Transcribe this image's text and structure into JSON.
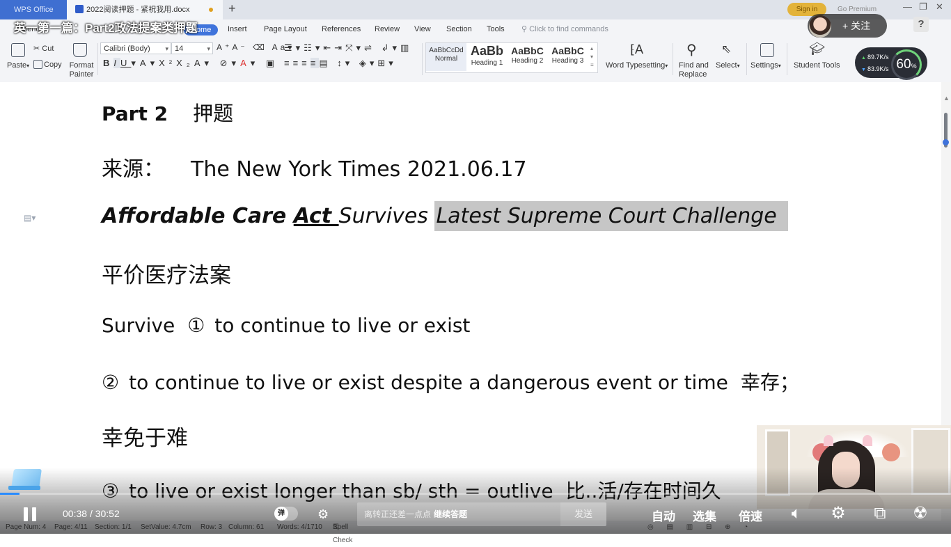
{
  "titlebar": {
    "wps_tab": "WPS Office",
    "doc_tab": "2022阅读押题 - 紧祝我用.docx",
    "new_tab": "+",
    "sign_in": "Sign in",
    "go_premium": "Go Premium"
  },
  "overlay": {
    "video_title": "英一第一篇：Part2政法提案类押题",
    "follow_label": "关注",
    "help": "?"
  },
  "menu": {
    "tabs": [
      "Menu",
      "Home",
      "Insert",
      "Page Layout",
      "References",
      "Review",
      "View",
      "Section",
      "Tools"
    ],
    "active_tab": "Home",
    "search_placeholder": "Click to find commands"
  },
  "ribbon": {
    "paste": "Paste",
    "cut": "Cut",
    "copy": "Copy",
    "format_painter": "Format Painter",
    "font_name": "Calibri (Body)",
    "font_size": "14",
    "styles": [
      {
        "preview": "AaBbCcDd",
        "label": "Normal"
      },
      {
        "preview": "AaBb",
        "label": "Heading 1"
      },
      {
        "preview": "AaBbC",
        "label": "Heading 2"
      },
      {
        "preview": "AaBbC",
        "label": "Heading 3"
      }
    ],
    "word_typesetting": "Word Typesetting",
    "find_replace": "Find and Replace",
    "select": "Select",
    "settings": "Settings",
    "student_tools": "Student Tools"
  },
  "speed_widget": {
    "upload": "89.7",
    "download": "83.9",
    "unit": "K/s",
    "percent": "60",
    "percent_sign": "%"
  },
  "document": {
    "part": "Part 2",
    "part_title": "押题",
    "source_label": "来源：",
    "source_value": "The New York Times 2021.06.17",
    "headline_bold1": "Affordable Care ",
    "headline_underlined": "Act ",
    "headline_normal": "Survives ",
    "headline_highlighted": "Latest Supreme Court Challenge",
    "translation": "平价医疗法案",
    "survive_word": "Survive",
    "def1_num": "①",
    "def1": "to continue to live or exist",
    "def2_num": "②",
    "def2": "to continue to live or exist despite a dangerous event or time",
    "def2_cn": "幸存；",
    "def2_cn2": "幸免于难",
    "def3_num": "③",
    "def3": "to live or exist longer than sb/ sth = outlive",
    "def3_cn": "比..活/存在时间久"
  },
  "statusbar": {
    "page_num": "Page Num: 4",
    "page": "Page: 4/11",
    "section": "Section: 1/1",
    "set_value": "SetValue: 4.7cm",
    "row": "Row: 3",
    "column": "Column: 61",
    "words": "Words: 4/1710",
    "spell_check": "Spell Check"
  },
  "player": {
    "current_time": "00:38",
    "separator": "/",
    "duration": "30:52",
    "progress_fraction": 0.0205,
    "danmu_knob": "弹",
    "danmu_placeholder": "离转正还差一点点",
    "danmu_cta": "继续答题",
    "send": "发送",
    "auto": "自动",
    "episodes": "选集",
    "speed": "倍速",
    "accent_color": "#2a8cff"
  }
}
